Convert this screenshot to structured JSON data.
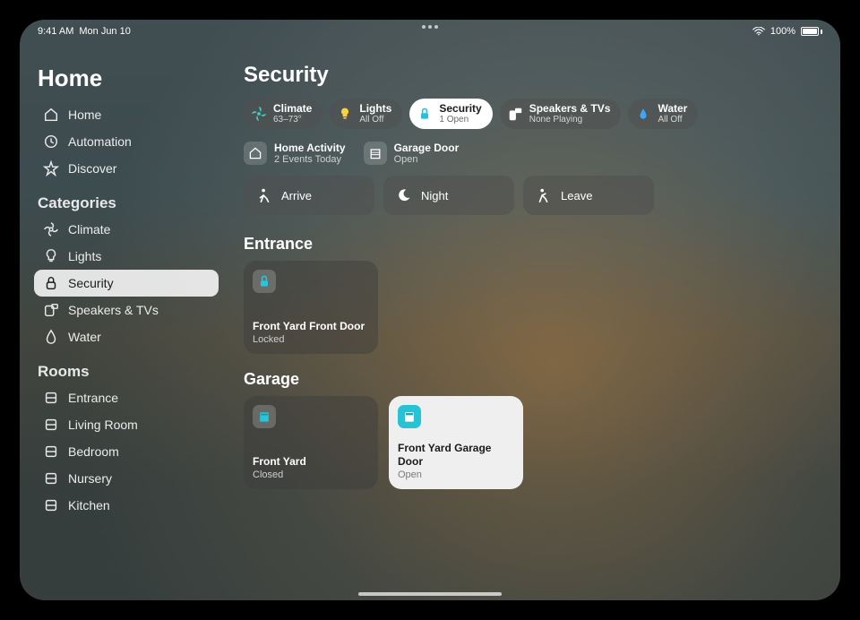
{
  "status": {
    "time": "9:41 AM",
    "date": "Mon Jun 10",
    "battery": "100%"
  },
  "sidebar": {
    "title": "Home",
    "nav": [
      {
        "label": "Home"
      },
      {
        "label": "Automation"
      },
      {
        "label": "Discover"
      }
    ],
    "categories_label": "Categories",
    "categories": [
      {
        "label": "Climate"
      },
      {
        "label": "Lights"
      },
      {
        "label": "Security"
      },
      {
        "label": "Speakers & TVs"
      },
      {
        "label": "Water"
      }
    ],
    "rooms_label": "Rooms",
    "rooms": [
      {
        "label": "Entrance"
      },
      {
        "label": "Living Room"
      },
      {
        "label": "Bedroom"
      },
      {
        "label": "Nursery"
      },
      {
        "label": "Kitchen"
      }
    ]
  },
  "main": {
    "title": "Security",
    "pills": [
      {
        "title": "Climate",
        "sub": "63–73°",
        "icon_color": "#3fd4c1"
      },
      {
        "title": "Lights",
        "sub": "All Off",
        "icon_color": "#ffd23a"
      },
      {
        "title": "Security",
        "sub": "1 Open",
        "icon_color": "#24c1d8"
      },
      {
        "title": "Speakers & TVs",
        "sub": "None Playing",
        "icon_color": "#ffffff"
      },
      {
        "title": "Water",
        "sub": "All Off",
        "icon_color": "#3aa6ff"
      }
    ],
    "activity": [
      {
        "title": "Home Activity",
        "sub": "2 Events Today"
      },
      {
        "title": "Garage Door",
        "sub": "Open"
      }
    ],
    "scenes": [
      {
        "label": "Arrive"
      },
      {
        "label": "Night"
      },
      {
        "label": "Leave"
      }
    ],
    "sections": [
      {
        "heading": "Entrance",
        "tiles": [
          {
            "title": "Front Yard Front Door",
            "sub": "Locked",
            "state": "dark",
            "icon": "lock",
            "icon_accent": "#27c5d8"
          }
        ]
      },
      {
        "heading": "Garage",
        "tiles": [
          {
            "title": "Front Yard",
            "sub": "Closed",
            "state": "dark",
            "icon": "garage",
            "icon_accent": "#27c5d8"
          },
          {
            "title": "Front Yard Garage Door",
            "sub": "Open",
            "state": "light",
            "icon": "garage",
            "icon_accent": "#ffffff"
          }
        ]
      }
    ]
  }
}
